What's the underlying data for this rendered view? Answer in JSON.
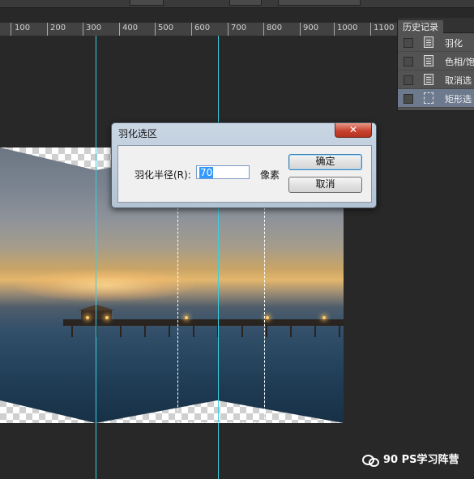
{
  "ruler": {
    "labels": [
      "100",
      "200",
      "300",
      "400",
      "500",
      "600",
      "700",
      "800",
      "900",
      "1000",
      "1100"
    ]
  },
  "history": {
    "tab_label": "历史记录",
    "items": [
      {
        "label": "羽化",
        "icon": "document-icon",
        "active": false
      },
      {
        "label": "色相/饱",
        "icon": "document-icon",
        "active": false
      },
      {
        "label": "取消选",
        "icon": "document-icon",
        "active": false
      },
      {
        "label": "矩形选",
        "icon": "rect-select-icon",
        "active": true
      }
    ]
  },
  "dialog": {
    "title": "羽化选区",
    "close_symbol": "✕",
    "field_label": "羽化半径(R):",
    "field_value": "70",
    "unit": "像素",
    "ok_label": "确定",
    "cancel_label": "取消"
  },
  "watermark": {
    "text": "90 PS学习阵营"
  },
  "colors": {
    "guide": "#39d0e0",
    "panel": "#535353",
    "active_row": "#6d7a8e",
    "close_button": "#c8432f"
  }
}
